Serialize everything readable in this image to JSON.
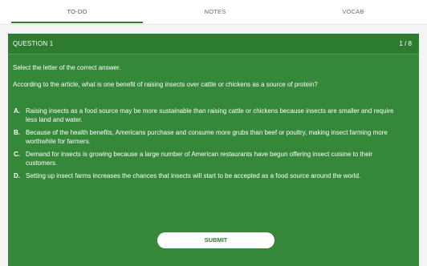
{
  "tabs": [
    {
      "label": "TO-DO",
      "active": true
    },
    {
      "label": "NOTES",
      "active": false
    },
    {
      "label": "VOCAB",
      "active": false
    }
  ],
  "question": {
    "label": "QUESTION 1",
    "counter": "1 / 8",
    "instruction": "Select the letter of the correct answer.",
    "prompt": "According to the article, what is one benefit of raising insects over cattle or chickens as a source of protein?",
    "options": [
      {
        "letter": "A.",
        "text": "Raising insects as a food source may be more sustainable than raising cattle or chickens because insects are smaller and require less land and water."
      },
      {
        "letter": "B.",
        "text": "Because of the health benefits, Americans purchase and consume more grubs than beef or poultry, making insect farming more worthwhile for farmers."
      },
      {
        "letter": "C.",
        "text": "Demand for insects is growing because a large number of American restaurants have begun offering insect cuisine to their customers."
      },
      {
        "letter": "D.",
        "text": "Setting up insect farms increases the chances that insects will start to be accepted as a food source around the world."
      }
    ]
  },
  "submit_label": "SUBMIT",
  "colors": {
    "accent": "#2e7d32",
    "card": "#35883a",
    "header": "#2e7b32"
  }
}
